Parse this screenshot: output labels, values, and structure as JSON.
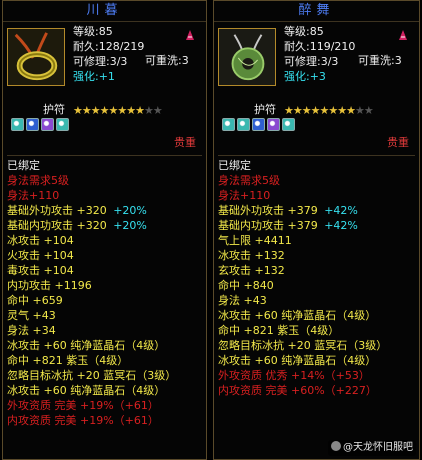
{
  "colors": {
    "white": "#f0f0f0",
    "red": "#d82020",
    "yellow": "#f2e84a",
    "green": "#1ec31e",
    "cyan": "#36e0ef",
    "gold": "#d8b43a",
    "blue": "#4d7cf2"
  },
  "panels": [
    {
      "title": "川暮",
      "icon": "ring-pendant-icon",
      "level": "等级:85",
      "durability": "耐久:128/219",
      "repairable": "可修理:3/3",
      "recastable": "可重洗:3",
      "enhance_label": "强化:",
      "enhance_value": "+1",
      "charm_label": "护符",
      "stars_filled": 8,
      "stars_total": 10,
      "gems": [
        "teal-gem-icon",
        "blue-gem-icon",
        "purple-gem-icon",
        "teal-gem-icon"
      ],
      "price": "贵重",
      "lines": [
        {
          "text": "已绑定",
          "color": "white"
        },
        {
          "text": "身法需求5级",
          "color": "red"
        },
        {
          "text": "身法+110",
          "color": "red"
        },
        {
          "text": "基础外功攻击 +320",
          "extra": "+20%",
          "color": "yellow",
          "extra_color": "cyan"
        },
        {
          "text": "基础内功攻击 +320",
          "extra": "+20%",
          "color": "yellow",
          "extra_color": "cyan"
        },
        {
          "text": "冰攻击 +104",
          "color": "yellow"
        },
        {
          "text": "火攻击 +104",
          "color": "yellow"
        },
        {
          "text": "毒攻击 +104",
          "color": "yellow"
        },
        {
          "text": "内功攻击 +1196",
          "color": "yellow"
        },
        {
          "text": "命中 +659",
          "color": "yellow"
        },
        {
          "text": "灵气 +43",
          "color": "yellow"
        },
        {
          "text": "身法 +34",
          "color": "yellow"
        },
        {
          "text": "冰攻击 +60  纯净蓝晶石（4级）",
          "color": "yellow"
        },
        {
          "text": "命中 +821  紫玉（4级）",
          "color": "yellow"
        },
        {
          "text": "忽略目标冰抗 +20  蓝冥石（3级）",
          "color": "yellow"
        },
        {
          "text": "冰攻击 +60  纯净蓝晶石（4级）",
          "color": "yellow"
        },
        {
          "text": "外攻资质    完美 +19%（+61）",
          "color": "red"
        },
        {
          "text": "内攻资质    完美 +19%（+61）",
          "color": "red"
        }
      ]
    },
    {
      "title": "醉舞",
      "icon": "jade-pendant-icon",
      "level": "等级:85",
      "durability": "耐久:119/210",
      "repairable": "可修理:3/3",
      "recastable": "可重洗:3",
      "enhance_label": "强化:",
      "enhance_value": "+3",
      "charm_label": "护符",
      "stars_filled": 8,
      "stars_total": 10,
      "gems": [
        "teal-gem-icon",
        "teal-gem-icon",
        "blue-gem-icon",
        "purple-gem-icon",
        "teal-gem-icon"
      ],
      "price": "贵重",
      "lines": [
        {
          "text": "已绑定",
          "color": "white"
        },
        {
          "text": "身法需求5级",
          "color": "red"
        },
        {
          "text": "身法+110",
          "color": "red"
        },
        {
          "text": "基础外功攻击 +379",
          "extra": "+42%",
          "color": "yellow",
          "extra_color": "cyan"
        },
        {
          "text": "基础内功攻击 +379",
          "extra": "+42%",
          "color": "yellow",
          "extra_color": "cyan"
        },
        {
          "text": "气上限 +4411",
          "color": "yellow"
        },
        {
          "text": "冰攻击 +132",
          "color": "yellow"
        },
        {
          "text": "玄攻击 +132",
          "color": "yellow"
        },
        {
          "text": "命中 +840",
          "color": "yellow"
        },
        {
          "text": "身法 +43",
          "color": "yellow"
        },
        {
          "text": "冰攻击 +60  纯净蓝晶石（4级）",
          "color": "yellow"
        },
        {
          "text": "命中 +821  紫玉（4级）",
          "color": "yellow"
        },
        {
          "text": "忽略目标冰抗 +20  蓝冥石（3级）",
          "color": "yellow"
        },
        {
          "text": "冰攻击 +60  纯净蓝晶石（4级）",
          "color": "yellow"
        },
        {
          "text": "外攻资质    优秀 +14%（+53）",
          "color": "red"
        },
        {
          "text": "内攻资质    完美 +60%（+227）",
          "color": "red"
        }
      ]
    }
  ],
  "watermark": "@天龙怀旧服吧"
}
